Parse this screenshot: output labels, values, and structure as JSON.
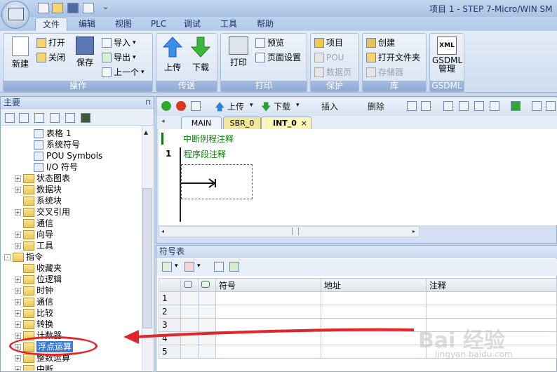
{
  "title_bar": {
    "title": "项目 1 - STEP 7-Micro/WIN SM"
  },
  "menu_tabs": [
    "文件",
    "编辑",
    "视图",
    "PLC",
    "调试",
    "工具",
    "帮助"
  ],
  "ribbon": {
    "groups": [
      {
        "label": "操作",
        "items": [
          "新建",
          "打开",
          "关闭",
          "保存",
          "导入",
          "导出",
          "上一个"
        ]
      },
      {
        "label": "传送",
        "items": [
          "上传",
          "下载"
        ]
      },
      {
        "label": "打印",
        "items": [
          "打印",
          "预览",
          "页面设置"
        ]
      },
      {
        "label": "保护",
        "items": [
          "项目",
          "POU",
          "数据页"
        ]
      },
      {
        "label": "库",
        "items": [
          "创建",
          "打开文件夹",
          "存储器"
        ]
      },
      {
        "label": "GSDML",
        "items": [
          "GSDML\n管理"
        ]
      }
    ],
    "xml_icon_text": "XML"
  },
  "left_pane": {
    "header": "主要",
    "tree": [
      {
        "label": "表格 1",
        "indent": 3,
        "expander": ""
      },
      {
        "label": "系统符号",
        "indent": 3,
        "expander": ""
      },
      {
        "label": "POU Symbols",
        "indent": 3,
        "expander": ""
      },
      {
        "label": "I/O 符号",
        "indent": 3,
        "expander": ""
      },
      {
        "label": "状态图表",
        "indent": 2,
        "expander": "+"
      },
      {
        "label": "数据块",
        "indent": 2,
        "expander": "+"
      },
      {
        "label": "系统块",
        "indent": 2,
        "expander": ""
      },
      {
        "label": "交叉引用",
        "indent": 2,
        "expander": "+"
      },
      {
        "label": "通信",
        "indent": 2,
        "expander": ""
      },
      {
        "label": "向导",
        "indent": 2,
        "expander": "+"
      },
      {
        "label": "工具",
        "indent": 2,
        "expander": "+"
      },
      {
        "label": "指令",
        "indent": 1,
        "expander": "-"
      },
      {
        "label": "收藏夹",
        "indent": 2,
        "expander": ""
      },
      {
        "label": "位逻辑",
        "indent": 2,
        "expander": "+"
      },
      {
        "label": "时钟",
        "indent": 2,
        "expander": "+"
      },
      {
        "label": "通信",
        "indent": 2,
        "expander": "+"
      },
      {
        "label": "比较",
        "indent": 2,
        "expander": "+"
      },
      {
        "label": "转换",
        "indent": 2,
        "expander": "+"
      },
      {
        "label": "计数器",
        "indent": 2,
        "expander": "+"
      },
      {
        "label": "浮点运算",
        "indent": 2,
        "expander": "+",
        "selected": true
      },
      {
        "label": "整数运算",
        "indent": 2,
        "expander": "+"
      },
      {
        "label": "中断",
        "indent": 2,
        "expander": "+"
      }
    ]
  },
  "editor": {
    "toolbar": [
      "上传",
      "下载",
      "插入",
      "删除"
    ],
    "tabs": [
      "MAIN",
      "SBR_0",
      "INT_0"
    ],
    "active_tab": "INT_0",
    "tab_close": "×",
    "routine_comment": "中断例程注释",
    "network_number": "1",
    "network_comment": "程序段注释"
  },
  "symbol_table": {
    "header": "符号表",
    "columns": [
      "符号",
      "地址",
      "注释"
    ],
    "rows": [
      "1",
      "2",
      "3",
      "4",
      "5"
    ]
  },
  "watermark": "Bai 经验",
  "watermark_sub": "jingyan.baidu.com",
  "colors": {
    "annotation_red": "#e0262b",
    "selection_blue": "#3b7bd6",
    "green_text": "#0a7a0a"
  }
}
